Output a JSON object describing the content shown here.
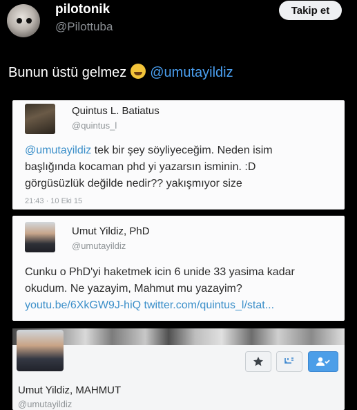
{
  "header": {
    "display_name": "pilotonik",
    "handle": "@Pilottuba",
    "follow_label": "Takip et"
  },
  "tweet": {
    "text": "Bunun üstü gelmez",
    "mention": "@umutayildiz"
  },
  "cards": [
    {
      "name": "Quintus L. Batiatus",
      "handle": "@quintus_l",
      "mention": "@umutayildiz",
      "body": " tek bir şey söyliyeceğim. Neden isim başlığında kocaman phd yi yazarsın isminin. :D görgüsüzlük değilde nedir?? yakışmıyor size",
      "time": "21:43 · 10 Eki 15"
    },
    {
      "name": "Umut Yildiz, PhD",
      "handle": "@umutayildiz",
      "body": "Cunku o PhD'yi haketmek icin 6 unide 33 yasima kadar okudum. Ne yazayim, Mahmut mu yazayim?",
      "link": "youtu.be/6XkGW9J-hiQ twitter.com/quintus_l/stat..."
    },
    {
      "name": "Umut Yildiz, MAHMUT",
      "handle": "@umutayildiz",
      "actions": [
        "star-icon",
        "list-add-icon",
        "follow-icon"
      ]
    }
  ],
  "colors": {
    "background": "#000000",
    "mention": "#4a9ff0",
    "card_link": "#3b8fc9",
    "follow_blue": "#4c9ee8"
  }
}
